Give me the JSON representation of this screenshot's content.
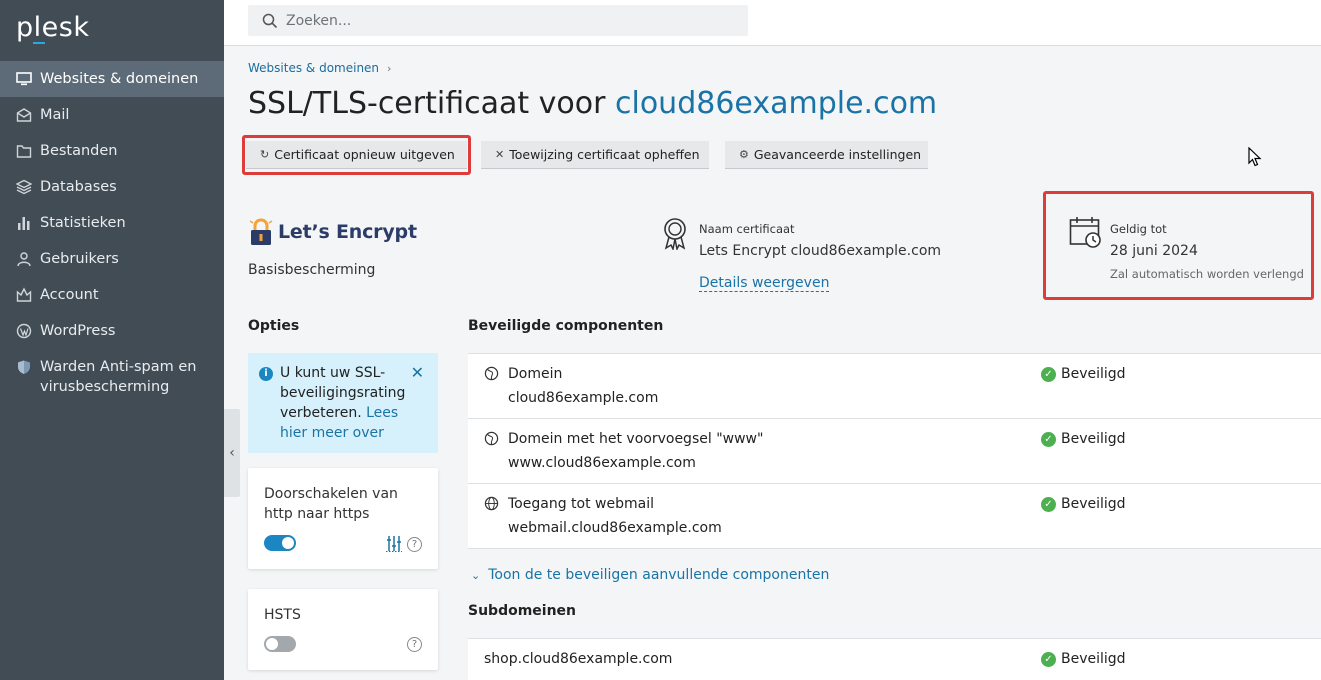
{
  "brand": {
    "logo": "plesk"
  },
  "sidebar": {
    "items": [
      {
        "label": "Websites & domeinen",
        "icon": "monitor-icon",
        "active": true
      },
      {
        "label": "Mail",
        "icon": "mail-icon"
      },
      {
        "label": "Bestanden",
        "icon": "folder-icon"
      },
      {
        "label": "Databases",
        "icon": "database-icon"
      },
      {
        "label": "Statistieken",
        "icon": "bar-chart-icon"
      },
      {
        "label": "Gebruikers",
        "icon": "user-icon"
      },
      {
        "label": "Account",
        "icon": "account-icon"
      },
      {
        "label": "WordPress",
        "icon": "wordpress-icon"
      },
      {
        "label": "Warden Anti-spam en virusbescherming",
        "icon": "shield-icon"
      }
    ]
  },
  "search": {
    "placeholder": "Zoeken..."
  },
  "breadcrumb": {
    "items": [
      "Websites & domeinen"
    ]
  },
  "page": {
    "title_prefix": "SSL/TLS-certificaat voor",
    "title_domain": "cloud86example.com"
  },
  "toolbar": {
    "reissue_label": "Certificaat opnieuw uitgeven",
    "unassign_label": "Toewijzing certificaat opheffen",
    "advanced_label": "Geavanceerde instellingen"
  },
  "certificate": {
    "provider_name": "Let’s Encrypt",
    "protection_level": "Basisbescherming",
    "name_label": "Naam certificaat",
    "name_value": "Lets Encrypt cloud86example.com",
    "details_link": "Details weergeven",
    "valid_label": "Geldig tot",
    "valid_date": "28 juni 2024",
    "valid_note": "Zal automatisch worden verlengd"
  },
  "options": {
    "heading": "Opties",
    "info_text": "U kunt uw SSL-beveiligingsrating verbeteren.",
    "info_link": "Lees hier meer over",
    "redirect": {
      "label": "Doorschakelen van http naar https",
      "enabled": true
    },
    "hsts": {
      "label": "HSTS",
      "enabled": false
    }
  },
  "secured_components": {
    "heading": "Beveiligde componenten",
    "rows": [
      {
        "name": "Domein",
        "domain": "cloud86example.com",
        "status": "Beveiligd",
        "icon": "domain-icon"
      },
      {
        "name": "Domein met het voorvoegsel \"www\"",
        "domain": "www.cloud86example.com",
        "status": "Beveiligd",
        "icon": "domain-icon"
      },
      {
        "name": "Toegang tot webmail",
        "domain": "webmail.cloud86example.com",
        "status": "Beveiligd",
        "icon": "globe-icon"
      }
    ],
    "show_more": "Toon de te beveiligen aanvullende componenten"
  },
  "subdomains": {
    "heading": "Subdomeinen",
    "rows": [
      {
        "domain": "shop.cloud86example.com",
        "status": "Beveiligd"
      }
    ]
  },
  "colors": {
    "sidebar_bg": "#414c55",
    "sidebar_active": "#5c6b77",
    "link": "#1a73a6",
    "highlight": "#de3b3b",
    "success": "#4caf50",
    "info_bg": "#d6f1fb"
  }
}
